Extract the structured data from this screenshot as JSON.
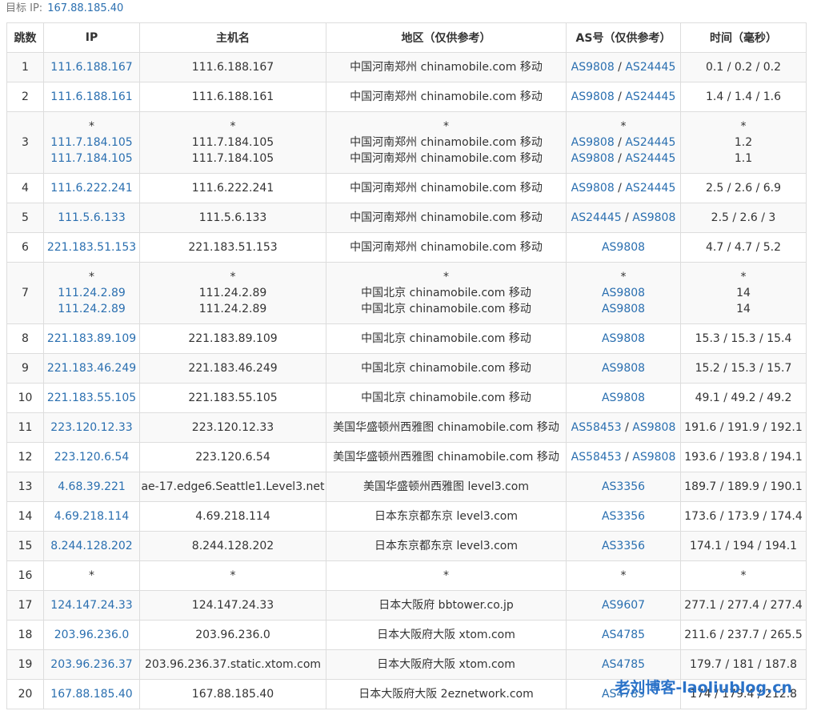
{
  "target": {
    "label": "目标 IP:",
    "ip": "167.88.185.40"
  },
  "columns": [
    "跳数",
    "IP",
    "主机名",
    "地区（仅供参考）",
    "AS号（仅供参考）",
    "时间（毫秒）"
  ],
  "hops": [
    {
      "hop": "1",
      "lines": [
        {
          "ip": "111.6.188.167",
          "host": "111.6.188.167",
          "region": "中国河南郑州 chinamobile.com 移动",
          "as": [
            "AS9808",
            "AS24445"
          ],
          "time": "0.1 / 0.2 / 0.2"
        }
      ]
    },
    {
      "hop": "2",
      "lines": [
        {
          "ip": "111.6.188.161",
          "host": "111.6.188.161",
          "region": "中国河南郑州 chinamobile.com 移动",
          "as": [
            "AS9808",
            "AS24445"
          ],
          "time": "1.4 / 1.4 / 1.6"
        }
      ]
    },
    {
      "hop": "3",
      "lines": [
        {
          "ip": "*",
          "host": "*",
          "region": "*",
          "as": [
            "*"
          ],
          "time": "*"
        },
        {
          "ip": "111.7.184.105",
          "host": "111.7.184.105",
          "region": "中国河南郑州 chinamobile.com 移动",
          "as": [
            "AS9808",
            "AS24445"
          ],
          "time": "1.2"
        },
        {
          "ip": "111.7.184.105",
          "host": "111.7.184.105",
          "region": "中国河南郑州 chinamobile.com 移动",
          "as": [
            "AS9808",
            "AS24445"
          ],
          "time": "1.1"
        }
      ]
    },
    {
      "hop": "4",
      "lines": [
        {
          "ip": "111.6.222.241",
          "host": "111.6.222.241",
          "region": "中国河南郑州 chinamobile.com 移动",
          "as": [
            "AS9808",
            "AS24445"
          ],
          "time": "2.5 / 2.6 / 6.9"
        }
      ]
    },
    {
      "hop": "5",
      "lines": [
        {
          "ip": "111.5.6.133",
          "host": "111.5.6.133",
          "region": "中国河南郑州 chinamobile.com 移动",
          "as": [
            "AS24445",
            "AS9808"
          ],
          "time": "2.5 / 2.6 / 3"
        }
      ]
    },
    {
      "hop": "6",
      "lines": [
        {
          "ip": "221.183.51.153",
          "host": "221.183.51.153",
          "region": "中国河南郑州 chinamobile.com 移动",
          "as": [
            "AS9808"
          ],
          "time": "4.7 / 4.7 / 5.2"
        }
      ]
    },
    {
      "hop": "7",
      "lines": [
        {
          "ip": "*",
          "host": "*",
          "region": "*",
          "as": [
            "*"
          ],
          "time": "*"
        },
        {
          "ip": "111.24.2.89",
          "host": "111.24.2.89",
          "region": "中国北京 chinamobile.com 移动",
          "as": [
            "AS9808"
          ],
          "time": "14"
        },
        {
          "ip": "111.24.2.89",
          "host": "111.24.2.89",
          "region": "中国北京 chinamobile.com 移动",
          "as": [
            "AS9808"
          ],
          "time": "14"
        }
      ]
    },
    {
      "hop": "8",
      "lines": [
        {
          "ip": "221.183.89.109",
          "host": "221.183.89.109",
          "region": "中国北京 chinamobile.com 移动",
          "as": [
            "AS9808"
          ],
          "time": "15.3 / 15.3 / 15.4"
        }
      ]
    },
    {
      "hop": "9",
      "lines": [
        {
          "ip": "221.183.46.249",
          "host": "221.183.46.249",
          "region": "中国北京 chinamobile.com 移动",
          "as": [
            "AS9808"
          ],
          "time": "15.2 / 15.3 / 15.7"
        }
      ]
    },
    {
      "hop": "10",
      "lines": [
        {
          "ip": "221.183.55.105",
          "host": "221.183.55.105",
          "region": "中国北京 chinamobile.com 移动",
          "as": [
            "AS9808"
          ],
          "time": "49.1 / 49.2 / 49.2"
        }
      ]
    },
    {
      "hop": "11",
      "lines": [
        {
          "ip": "223.120.12.33",
          "host": "223.120.12.33",
          "region": "美国华盛顿州西雅图 chinamobile.com 移动",
          "as": [
            "AS58453",
            "AS9808"
          ],
          "time": "191.6 / 191.9 / 192.1"
        }
      ]
    },
    {
      "hop": "12",
      "lines": [
        {
          "ip": "223.120.6.54",
          "host": "223.120.6.54",
          "region": "美国华盛顿州西雅图 chinamobile.com 移动",
          "as": [
            "AS58453",
            "AS9808"
          ],
          "time": "193.6 / 193.8 / 194.1"
        }
      ]
    },
    {
      "hop": "13",
      "lines": [
        {
          "ip": "4.68.39.221",
          "host": "ae-17.edge6.Seattle1.Level3.net",
          "region": "美国华盛顿州西雅图 level3.com",
          "as": [
            "AS3356"
          ],
          "time": "189.7 / 189.9 / 190.1"
        }
      ]
    },
    {
      "hop": "14",
      "lines": [
        {
          "ip": "4.69.218.114",
          "host": "4.69.218.114",
          "region": "日本东京都东京 level3.com",
          "as": [
            "AS3356"
          ],
          "time": "173.6 / 173.9 / 174.4"
        }
      ]
    },
    {
      "hop": "15",
      "lines": [
        {
          "ip": "8.244.128.202",
          "host": "8.244.128.202",
          "region": "日本东京都东京 level3.com",
          "as": [
            "AS3356"
          ],
          "time": "174.1 / 194 / 194.1"
        }
      ]
    },
    {
      "hop": "16",
      "lines": [
        {
          "ip": "*",
          "host": "*",
          "region": "*",
          "as": [
            "*"
          ],
          "time": "*"
        }
      ]
    },
    {
      "hop": "17",
      "lines": [
        {
          "ip": "124.147.24.33",
          "host": "124.147.24.33",
          "region": "日本大阪府 bbtower.co.jp",
          "as": [
            "AS9607"
          ],
          "time": "277.1 / 277.4 / 277.4"
        }
      ]
    },
    {
      "hop": "18",
      "lines": [
        {
          "ip": "203.96.236.0",
          "host": "203.96.236.0",
          "region": "日本大阪府大阪 xtom.com",
          "as": [
            "AS4785"
          ],
          "time": "211.6 / 237.7 / 265.5"
        }
      ]
    },
    {
      "hop": "19",
      "lines": [
        {
          "ip": "203.96.236.37",
          "host": "203.96.236.37.static.xtom.com",
          "region": "日本大阪府大阪 xtom.com",
          "as": [
            "AS4785"
          ],
          "time": "179.7 / 181 / 187.8"
        }
      ]
    },
    {
      "hop": "20",
      "lines": [
        {
          "ip": "167.88.185.40",
          "host": "167.88.185.40",
          "region": "日本大阪府大阪 2eznetwork.com",
          "as": [
            "AS4785"
          ],
          "time": "174 / 179.4 / 212.8"
        }
      ]
    }
  ],
  "watermark": "老刘博客-laoliublog.cn",
  "colors": {
    "link": "#2a6fb0",
    "stripe": "#f9f9f9",
    "border": "#dddddd",
    "watermark": "#2a72c8"
  }
}
